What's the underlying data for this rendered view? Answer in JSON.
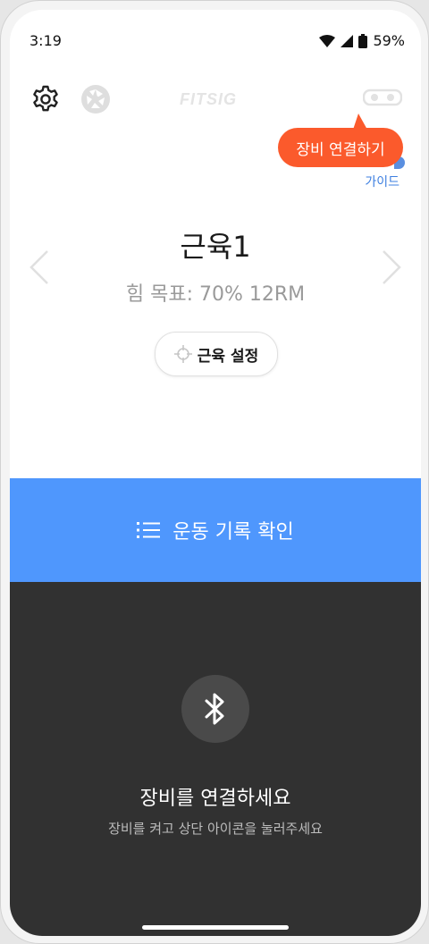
{
  "status_bar": {
    "time": "3:19",
    "battery": "59%"
  },
  "header": {
    "logo": "FITSIG"
  },
  "tooltip": {
    "text": "장비 연결하기"
  },
  "guide_link": "가이드",
  "muscle": {
    "title": "근육1",
    "goal": "힘 목표: 70% 12RM",
    "setting_button": "근육 설정"
  },
  "records_button": "운동 기록 확인",
  "connect": {
    "title": "장비를 연결하세요",
    "subtitle": "장비를 켜고 상단 아이콘을 눌러주세요"
  },
  "icons": {
    "settings": "gear-icon",
    "camera": "camera-shutter-icon",
    "device": "device-link-icon",
    "target": "crosshair-icon",
    "list": "list-icon",
    "bluetooth": "bluetooth-icon"
  },
  "colors": {
    "accent_blue": "#4f97fd",
    "tooltip_orange": "#fb5a2c",
    "dark_panel": "#313131",
    "link_blue": "#3d7fe0"
  }
}
